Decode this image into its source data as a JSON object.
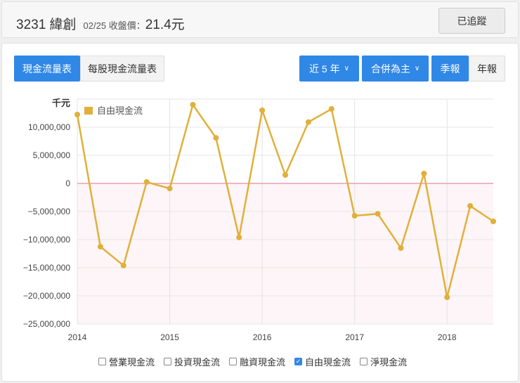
{
  "header": {
    "code_name": "3231 緯創",
    "date_label": "02/25 收盤價：",
    "price": "21.4元",
    "track_button": "已追蹤"
  },
  "tabs": [
    "現金流量表",
    "每股現金流量表"
  ],
  "controls": {
    "range": "近 5 年",
    "basis": "合併為主",
    "quarterly": "季報",
    "annual": "年報"
  },
  "colors": {
    "accent": "#2f87e6",
    "series": "#e0b03a",
    "zero": "#e8a0b0"
  },
  "chart_data": {
    "type": "line",
    "unit": "千元",
    "ylim": [
      -25000000,
      15000000
    ],
    "yticks": [
      "10,000,000",
      "5,000,000",
      "0",
      "−5,000,000",
      "−10,000,000",
      "−15,000,000",
      "−20,000,000",
      "−25,000,000"
    ],
    "ytick_values": [
      10000000,
      5000000,
      0,
      -5000000,
      -10000000,
      -15000000,
      -20000000,
      -25000000
    ],
    "xticks": [
      "2014",
      "2015",
      "2016",
      "2017",
      "2018"
    ],
    "x": [
      2014,
      2014.25,
      2014.5,
      2014.75,
      2015,
      2015.25,
      2015.5,
      2015.75,
      2016,
      2016.25,
      2016.5,
      2016.75,
      2017,
      2017.25,
      2017.5,
      2017.75,
      2018,
      2018.25,
      2018.5
    ],
    "series": [
      {
        "name": "自由現金流",
        "values": [
          12250000,
          -11250000,
          -14600000,
          250000,
          -900000,
          14000000,
          8100000,
          -9600000,
          13000000,
          1500000,
          10900000,
          13250000,
          -5750000,
          -5400000,
          -11500000,
          1750000,
          -20250000,
          -4000000,
          -6750000
        ]
      }
    ],
    "legend": "top-left"
  },
  "bottom_legend": [
    {
      "label": "營業現金流",
      "checked": false
    },
    {
      "label": "投資現金流",
      "checked": false
    },
    {
      "label": "融資現金流",
      "checked": false
    },
    {
      "label": "自由現金流",
      "checked": true
    },
    {
      "label": "淨現金流",
      "checked": false
    }
  ]
}
